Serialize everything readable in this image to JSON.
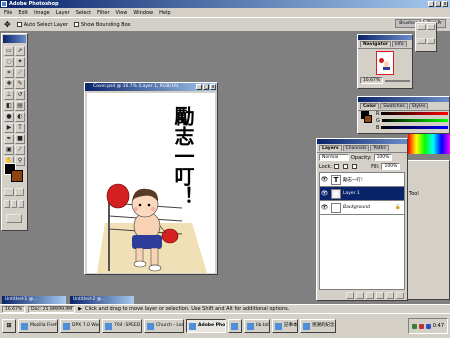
{
  "app": {
    "title": "Adobe Photoshop"
  },
  "menu": [
    "File",
    "Edit",
    "Image",
    "Layer",
    "Select",
    "Filter",
    "View",
    "Window",
    "Help"
  ],
  "options": {
    "auto_select": "Auto Select Layer",
    "show_bbox": "Show Bounding Box"
  },
  "palette_well": [
    "Brushes",
    "Tool Pr"
  ],
  "document": {
    "title": "Cover.psd @ 16.7% (Layer 1, RGB/16)",
    "art_text": "勵志一叮！"
  },
  "navigator": {
    "tabs": [
      "Navigator",
      "Info"
    ],
    "zoom": "16.67%"
  },
  "color": {
    "tabs": [
      "Color",
      "Swatches",
      "Styles"
    ],
    "labels": [
      "R",
      "G",
      "B"
    ]
  },
  "layers": {
    "tabs": [
      "Layers",
      "Channels",
      "Paths"
    ],
    "mode": "Normal",
    "opacity_label": "Opacity:",
    "opacity": "100%",
    "lock_label": "Lock:",
    "fill_label": "Fill:",
    "fill": "100%",
    "rows": [
      {
        "thumb": "T",
        "name": "勵志一叮!"
      },
      {
        "thumb": "",
        "name": "Layer 1"
      },
      {
        "thumb": "",
        "name": "Background"
      }
    ]
  },
  "extra_panel": {
    "label": "Tool"
  },
  "minimized": [
    "Untitled-1 @...",
    "Untitled-2 @..."
  ],
  "status": {
    "zoom": "16.67%",
    "doc": "Doc: 25.8M/99.9M",
    "hint": "Click and drag to move layer or selection. Use Shift and Alt for additional options."
  },
  "taskbar": {
    "start": "⊞",
    "buttons": [
      "Mozilla Firefox",
      "DPX 7.0 Work...",
      "704 :SPEED -...",
      "Church - LeaDet",
      "Adobe Phot...",
      "",
      "lib.txt",
      "記事本",
      "感謝的紀念 4..."
    ],
    "clock": "0:47"
  },
  "colors": {
    "fg": "#000000",
    "bg": "#8b4513"
  }
}
